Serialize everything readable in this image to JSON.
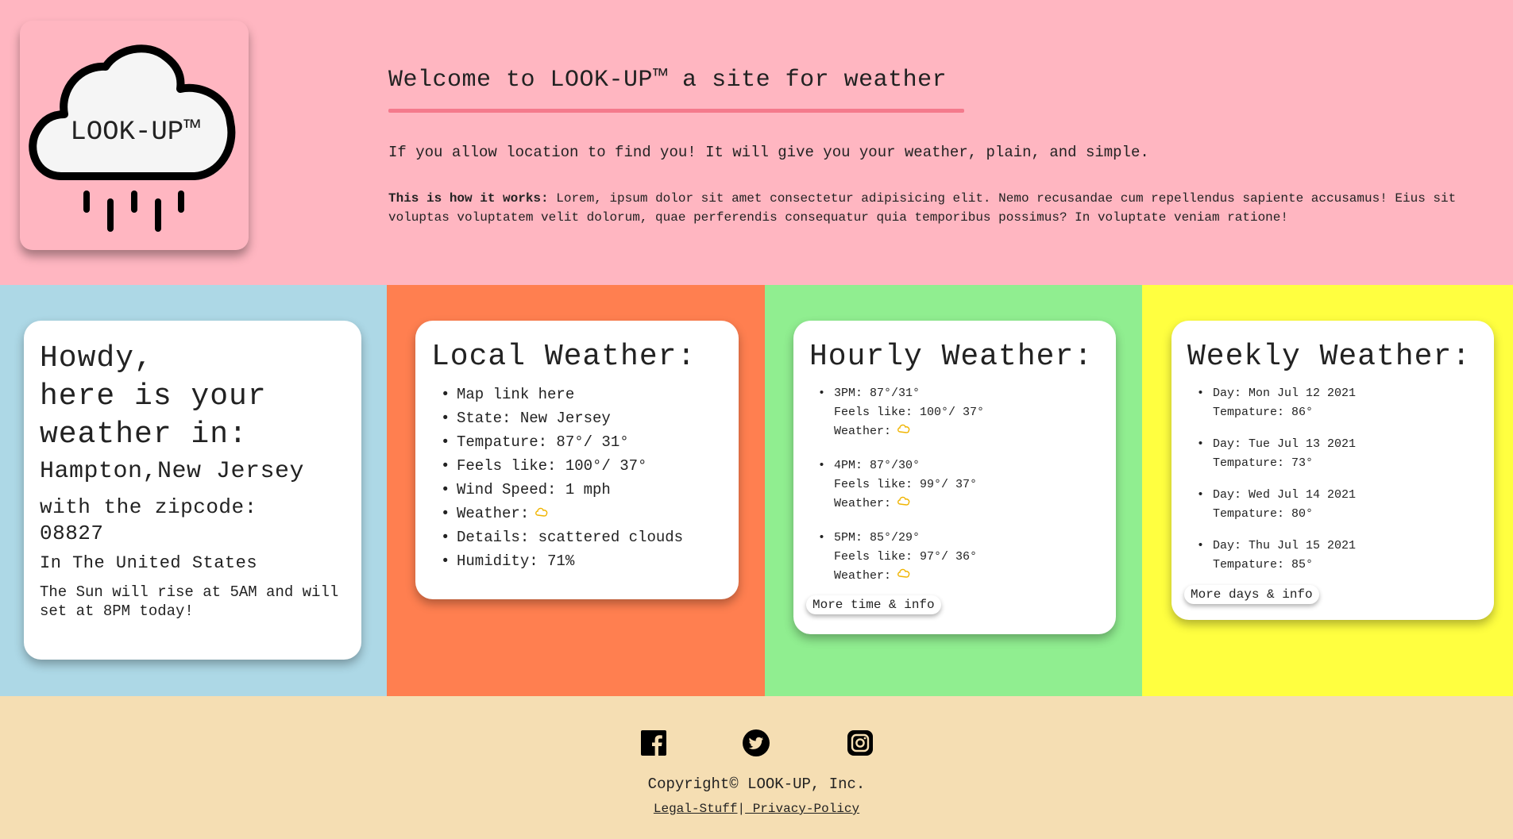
{
  "header": {
    "logo_text": "LOOK-UP™",
    "welcome": "Welcome to LOOK-UP™ a site for weather",
    "tagline": "If you allow location to find you! It will give you your weather, plain, and simple.",
    "how_label": "This is how it works:",
    "how_text": " Lorem, ipsum dolor sit amet consectetur adipisicing elit. Nemo recusandae cum repellendus sapiente accusamus! Eius sit voluptas voluptatem velit dolorum, quae perferendis consequatur quia temporibus possimus? In voluptate veniam ratione!"
  },
  "howdy": {
    "line1": "Howdy,",
    "line2": "here is your",
    "line3": "weather in:",
    "place": "Hampton,New Jersey",
    "zip_label": "with the zipcode:",
    "zip": "08827",
    "country": "In The United States",
    "sun": "The Sun will rise at 5AM and will set at 8PM today!"
  },
  "local": {
    "title": "Local Weather:",
    "items": [
      "Map link here",
      "State: New Jersey",
      "Tempature: 87°/ 31°",
      "Feels like: 100°/ 37°",
      "Wind Speed: 1 mph",
      "Weather:",
      "Details: scattered clouds",
      "Humidity: 71%"
    ]
  },
  "hourly": {
    "title": "Hourly Weather:",
    "items": [
      {
        "time": "3PM: 87°/31°",
        "feels": "Feels like: 100°/ 37°",
        "weather": "Weather:"
      },
      {
        "time": "4PM: 87°/30°",
        "feels": "Feels like: 99°/ 37°",
        "weather": "Weather:"
      },
      {
        "time": "5PM: 85°/29°",
        "feels": "Feels like: 97°/ 36°",
        "weather": "Weather:"
      }
    ],
    "more": "More time & info"
  },
  "weekly": {
    "title": "Weekly Weather:",
    "items": [
      {
        "day": "Day: Mon Jul 12 2021",
        "temp": "Tempature: 86°"
      },
      {
        "day": "Day: Tue Jul 13 2021",
        "temp": "Tempature: 73°"
      },
      {
        "day": "Day: Wed Jul 14 2021",
        "temp": "Tempature: 80°"
      },
      {
        "day": "Day: Thu Jul 15 2021",
        "temp": "Tempature: 85°"
      }
    ],
    "more": "More days & info"
  },
  "footer": {
    "social": [
      "facebook-icon",
      "twitter-icon",
      "instagram-icon"
    ],
    "copyright": "Copyright© LOOK-UP, Inc.",
    "legal": "Legal-Stuff",
    "separator": "|",
    "privacy": " Privacy-Policy"
  },
  "colors": {
    "header_bg": "#ffb6c1",
    "col1_bg": "#add8e6",
    "col2_bg": "#ff7f50",
    "col3_bg": "#90ee90",
    "col4_bg": "#ffff40",
    "footer_bg": "#f5deb3",
    "accent_underline": "#f47a8c",
    "cloud_icon": "#f0b400"
  }
}
